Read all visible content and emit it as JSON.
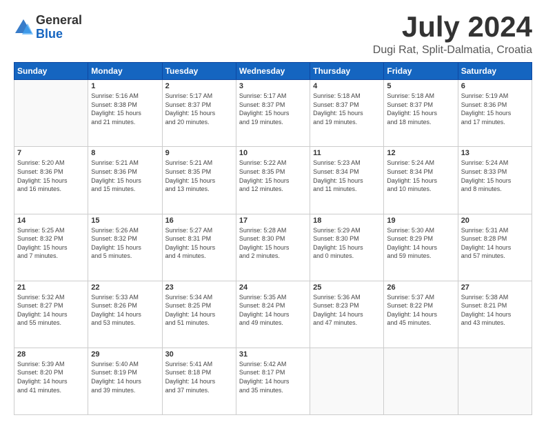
{
  "logo": {
    "general": "General",
    "blue": "Blue"
  },
  "title": "July 2024",
  "subtitle": "Dugi Rat, Split-Dalmatia, Croatia",
  "days_header": [
    "Sunday",
    "Monday",
    "Tuesday",
    "Wednesday",
    "Thursday",
    "Friday",
    "Saturday"
  ],
  "weeks": [
    [
      {
        "day": "",
        "info": ""
      },
      {
        "day": "1",
        "info": "Sunrise: 5:16 AM\nSunset: 8:38 PM\nDaylight: 15 hours\nand 21 minutes."
      },
      {
        "day": "2",
        "info": "Sunrise: 5:17 AM\nSunset: 8:37 PM\nDaylight: 15 hours\nand 20 minutes."
      },
      {
        "day": "3",
        "info": "Sunrise: 5:17 AM\nSunset: 8:37 PM\nDaylight: 15 hours\nand 19 minutes."
      },
      {
        "day": "4",
        "info": "Sunrise: 5:18 AM\nSunset: 8:37 PM\nDaylight: 15 hours\nand 19 minutes."
      },
      {
        "day": "5",
        "info": "Sunrise: 5:18 AM\nSunset: 8:37 PM\nDaylight: 15 hours\nand 18 minutes."
      },
      {
        "day": "6",
        "info": "Sunrise: 5:19 AM\nSunset: 8:36 PM\nDaylight: 15 hours\nand 17 minutes."
      }
    ],
    [
      {
        "day": "7",
        "info": ""
      },
      {
        "day": "8",
        "info": "Sunrise: 5:21 AM\nSunset: 8:36 PM\nDaylight: 15 hours\nand 15 minutes."
      },
      {
        "day": "9",
        "info": "Sunrise: 5:21 AM\nSunset: 8:35 PM\nDaylight: 15 hours\nand 13 minutes."
      },
      {
        "day": "10",
        "info": "Sunrise: 5:22 AM\nSunset: 8:35 PM\nDaylight: 15 hours\nand 12 minutes."
      },
      {
        "day": "11",
        "info": "Sunrise: 5:23 AM\nSunset: 8:34 PM\nDaylight: 15 hours\nand 11 minutes."
      },
      {
        "day": "12",
        "info": "Sunrise: 5:24 AM\nSunset: 8:34 PM\nDaylight: 15 hours\nand 10 minutes."
      },
      {
        "day": "13",
        "info": "Sunrise: 5:24 AM\nSunset: 8:33 PM\nDaylight: 15 hours\nand 8 minutes."
      }
    ],
    [
      {
        "day": "14",
        "info": "Sunrise: 5:25 AM\nSunset: 8:32 PM\nDaylight: 15 hours\nand 7 minutes."
      },
      {
        "day": "15",
        "info": "Sunrise: 5:26 AM\nSunset: 8:32 PM\nDaylight: 15 hours\nand 5 minutes."
      },
      {
        "day": "16",
        "info": "Sunrise: 5:27 AM\nSunset: 8:31 PM\nDaylight: 15 hours\nand 4 minutes."
      },
      {
        "day": "17",
        "info": "Sunrise: 5:28 AM\nSunset: 8:30 PM\nDaylight: 15 hours\nand 2 minutes."
      },
      {
        "day": "18",
        "info": "Sunrise: 5:29 AM\nSunset: 8:30 PM\nDaylight: 15 hours\nand 0 minutes."
      },
      {
        "day": "19",
        "info": "Sunrise: 5:30 AM\nSunset: 8:29 PM\nDaylight: 14 hours\nand 59 minutes."
      },
      {
        "day": "20",
        "info": "Sunrise: 5:31 AM\nSunset: 8:28 PM\nDaylight: 14 hours\nand 57 minutes."
      }
    ],
    [
      {
        "day": "21",
        "info": "Sunrise: 5:32 AM\nSunset: 8:27 PM\nDaylight: 14 hours\nand 55 minutes."
      },
      {
        "day": "22",
        "info": "Sunrise: 5:33 AM\nSunset: 8:26 PM\nDaylight: 14 hours\nand 53 minutes."
      },
      {
        "day": "23",
        "info": "Sunrise: 5:34 AM\nSunset: 8:25 PM\nDaylight: 14 hours\nand 51 minutes."
      },
      {
        "day": "24",
        "info": "Sunrise: 5:35 AM\nSunset: 8:24 PM\nDaylight: 14 hours\nand 49 minutes."
      },
      {
        "day": "25",
        "info": "Sunrise: 5:36 AM\nSunset: 8:23 PM\nDaylight: 14 hours\nand 47 minutes."
      },
      {
        "day": "26",
        "info": "Sunrise: 5:37 AM\nSunset: 8:22 PM\nDaylight: 14 hours\nand 45 minutes."
      },
      {
        "day": "27",
        "info": "Sunrise: 5:38 AM\nSunset: 8:21 PM\nDaylight: 14 hours\nand 43 minutes."
      }
    ],
    [
      {
        "day": "28",
        "info": "Sunrise: 5:39 AM\nSunset: 8:20 PM\nDaylight: 14 hours\nand 41 minutes."
      },
      {
        "day": "29",
        "info": "Sunrise: 5:40 AM\nSunset: 8:19 PM\nDaylight: 14 hours\nand 39 minutes."
      },
      {
        "day": "30",
        "info": "Sunrise: 5:41 AM\nSunset: 8:18 PM\nDaylight: 14 hours\nand 37 minutes."
      },
      {
        "day": "31",
        "info": "Sunrise: 5:42 AM\nSunset: 8:17 PM\nDaylight: 14 hours\nand 35 minutes."
      },
      {
        "day": "",
        "info": ""
      },
      {
        "day": "",
        "info": ""
      },
      {
        "day": "",
        "info": ""
      }
    ]
  ],
  "week7_sunday": {
    "day": "7",
    "info": "Sunrise: 5:20 AM\nSunset: 8:36 PM\nDaylight: 15 hours\nand 16 minutes."
  }
}
